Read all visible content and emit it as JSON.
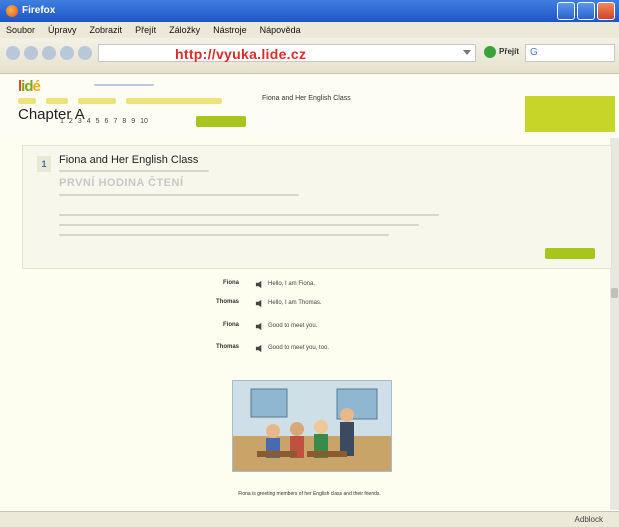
{
  "window": {
    "title": "Firefox"
  },
  "menu": [
    "Soubor",
    "Úpravy",
    "Zobrazit",
    "Přejít",
    "Záložky",
    "Nástroje",
    "Nápověda"
  ],
  "toolbar": {
    "url": "http://vyuka.lide.cz",
    "go_label": "Přejít",
    "search_icon": "G"
  },
  "site": {
    "logo": [
      "l",
      "i",
      "d",
      "é"
    ],
    "chapter": "Chapter A",
    "page_crumb": "Fiona and Her English Class",
    "pager": [
      "1",
      "2",
      "3",
      "4",
      "5",
      "6",
      "7",
      "8",
      "9",
      "10"
    ]
  },
  "lesson": {
    "number": "1",
    "title": "Fiona and Her English Class",
    "section_head": "PRVNÍ HODINA ČTENÍ"
  },
  "dialogue": [
    {
      "speaker": "Fiona",
      "text": "Hello, I am Fiona."
    },
    {
      "speaker": "Thomas",
      "text": "Hello, I am Thomas."
    },
    {
      "speaker": "Fiona",
      "text": "Good to meet you."
    },
    {
      "speaker": "Thomas",
      "text": "Good to meet you, too."
    }
  ],
  "caption": "Fiona is greeting members of her English class and their friends.",
  "status": {
    "text": "Adblock"
  },
  "colors": {
    "url_red": "#e02a2a",
    "accent_green": "#a8c51e",
    "title_blue": "#2a62d0"
  }
}
